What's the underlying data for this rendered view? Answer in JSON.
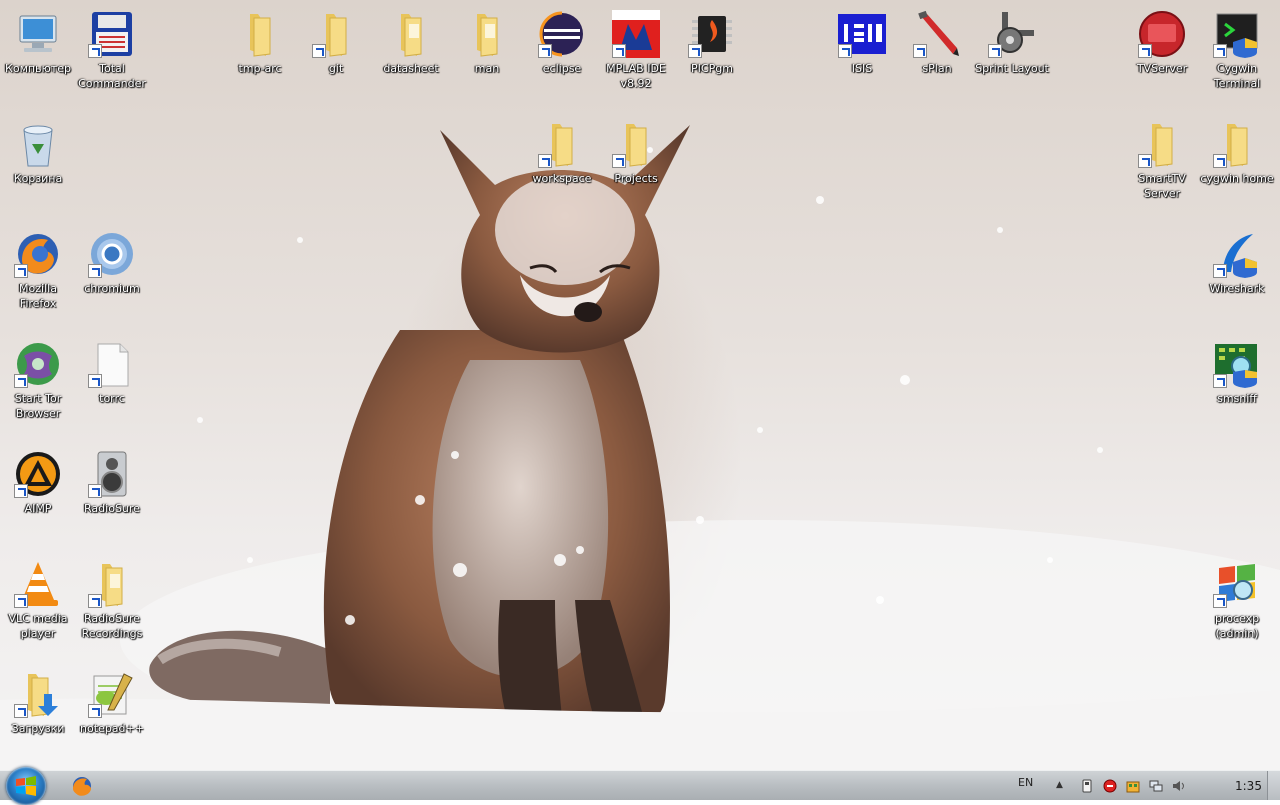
{
  "desktop": {
    "icons": [
      {
        "label": "Компьютер",
        "icon": "computer-icon",
        "shortcut": false
      },
      {
        "label": "Total Commander",
        "icon": "total-commander-icon",
        "shortcut": true
      },
      {
        "label": "tmp-arc",
        "icon": "folder-icon",
        "shortcut": false
      },
      {
        "label": "git",
        "icon": "folder-icon",
        "shortcut": true
      },
      {
        "label": "datasheet",
        "icon": "folder-icon",
        "shortcut": false
      },
      {
        "label": "man",
        "icon": "folder-icon",
        "shortcut": false
      },
      {
        "label": "eclipse",
        "icon": "eclipse-icon",
        "shortcut": true
      },
      {
        "label": "MPLAB IDE v8.92",
        "icon": "mplab-icon",
        "shortcut": true
      },
      {
        "label": "PICPgm",
        "icon": "chip-icon",
        "shortcut": true
      },
      {
        "label": "ISIS",
        "icon": "isis-icon",
        "shortcut": true
      },
      {
        "label": "sPlan",
        "icon": "pencil-icon",
        "shortcut": true
      },
      {
        "label": "Sprint Layout",
        "icon": "sprint-layout-icon",
        "shortcut": true
      },
      {
        "label": "TVServer",
        "icon": "tv-icon",
        "shortcut": true
      },
      {
        "label": "Cygwin Terminal",
        "icon": "terminal-icon",
        "shortcut": true
      },
      {
        "label": "Корзина",
        "icon": "recycle-bin-icon",
        "shortcut": false
      },
      {
        "label": "workspace",
        "icon": "folder-icon",
        "shortcut": true
      },
      {
        "label": "Projects",
        "icon": "folder-icon",
        "shortcut": true
      },
      {
        "label": "SmartTV Server",
        "icon": "folder-icon",
        "shortcut": true
      },
      {
        "label": "cygwin home",
        "icon": "folder-icon",
        "shortcut": true
      },
      {
        "label": "Mozilla Firefox",
        "icon": "firefox-icon",
        "shortcut": true
      },
      {
        "label": "chromium",
        "icon": "chromium-icon",
        "shortcut": true
      },
      {
        "label": "Wireshark",
        "icon": "wireshark-icon",
        "shortcut": true
      },
      {
        "label": "Start Tor Browser",
        "icon": "tor-icon",
        "shortcut": true
      },
      {
        "label": "torrc",
        "icon": "file-icon",
        "shortcut": true
      },
      {
        "label": "smsniff",
        "icon": "smsniff-icon",
        "shortcut": true
      },
      {
        "label": "AIMP",
        "icon": "aimp-icon",
        "shortcut": true
      },
      {
        "label": "RadioSure",
        "icon": "speaker-icon",
        "shortcut": true
      },
      {
        "label": "VLC media player",
        "icon": "vlc-icon",
        "shortcut": true
      },
      {
        "label": "RadioSure Recordings",
        "icon": "folder-icon",
        "shortcut": true
      },
      {
        "label": "procexp (admin)",
        "icon": "procexp-icon",
        "shortcut": true
      },
      {
        "label": "Загрузки",
        "icon": "downloads-folder-icon",
        "shortcut": true
      },
      {
        "label": "notepad++",
        "icon": "notepadpp-icon",
        "shortcut": true
      }
    ]
  },
  "taskbar": {
    "language": "EN",
    "clock": "1:35",
    "start_icon": "windows-logo-icon",
    "pinned": [
      "firefox-icon"
    ],
    "tray_icons": [
      "safely-remove-icon",
      "antivirus-icon",
      "network-app-icon",
      "network-icon",
      "volume-icon"
    ]
  },
  "colors": {
    "label_text": "#ffffff",
    "folder": "#f3d26b",
    "taskbar": "#b9bec2"
  }
}
